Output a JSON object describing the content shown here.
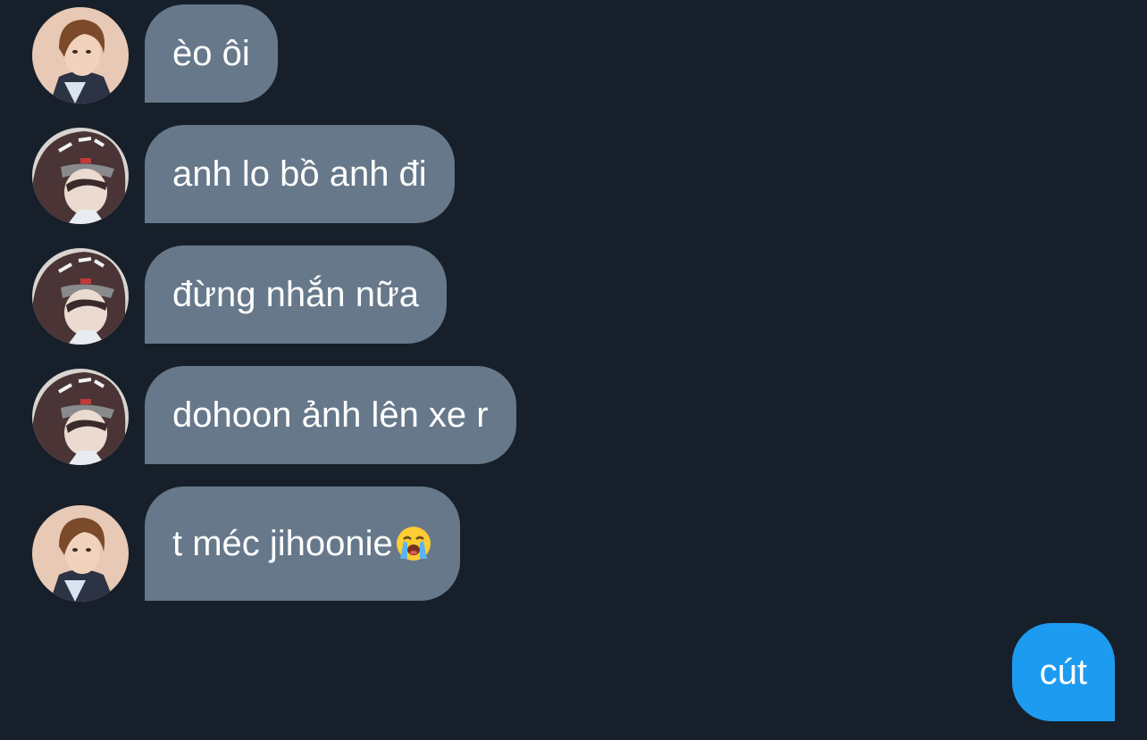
{
  "messages": [
    {
      "sender": "received",
      "avatar": "avatar-boy-brown-hair",
      "text": "èo ôi"
    },
    {
      "sender": "received",
      "avatar": "avatar-boy-hood",
      "text": "anh lo bồ anh đi"
    },
    {
      "sender": "received",
      "avatar": "avatar-boy-hood",
      "text": "đừng nhắn nữa"
    },
    {
      "sender": "received",
      "avatar": "avatar-boy-hood",
      "text": "dohoon ảnh lên xe r"
    },
    {
      "sender": "received",
      "avatar": "avatar-boy-brown-hair",
      "text": "t méc jihoonie",
      "emoji": "loudly-crying-face"
    },
    {
      "sender": "sent",
      "text": "cút"
    }
  ],
  "colors": {
    "background": "#17202a",
    "received_bubble": "#66788a",
    "sent_bubble": "#1d9bf0",
    "text": "#ffffff"
  }
}
